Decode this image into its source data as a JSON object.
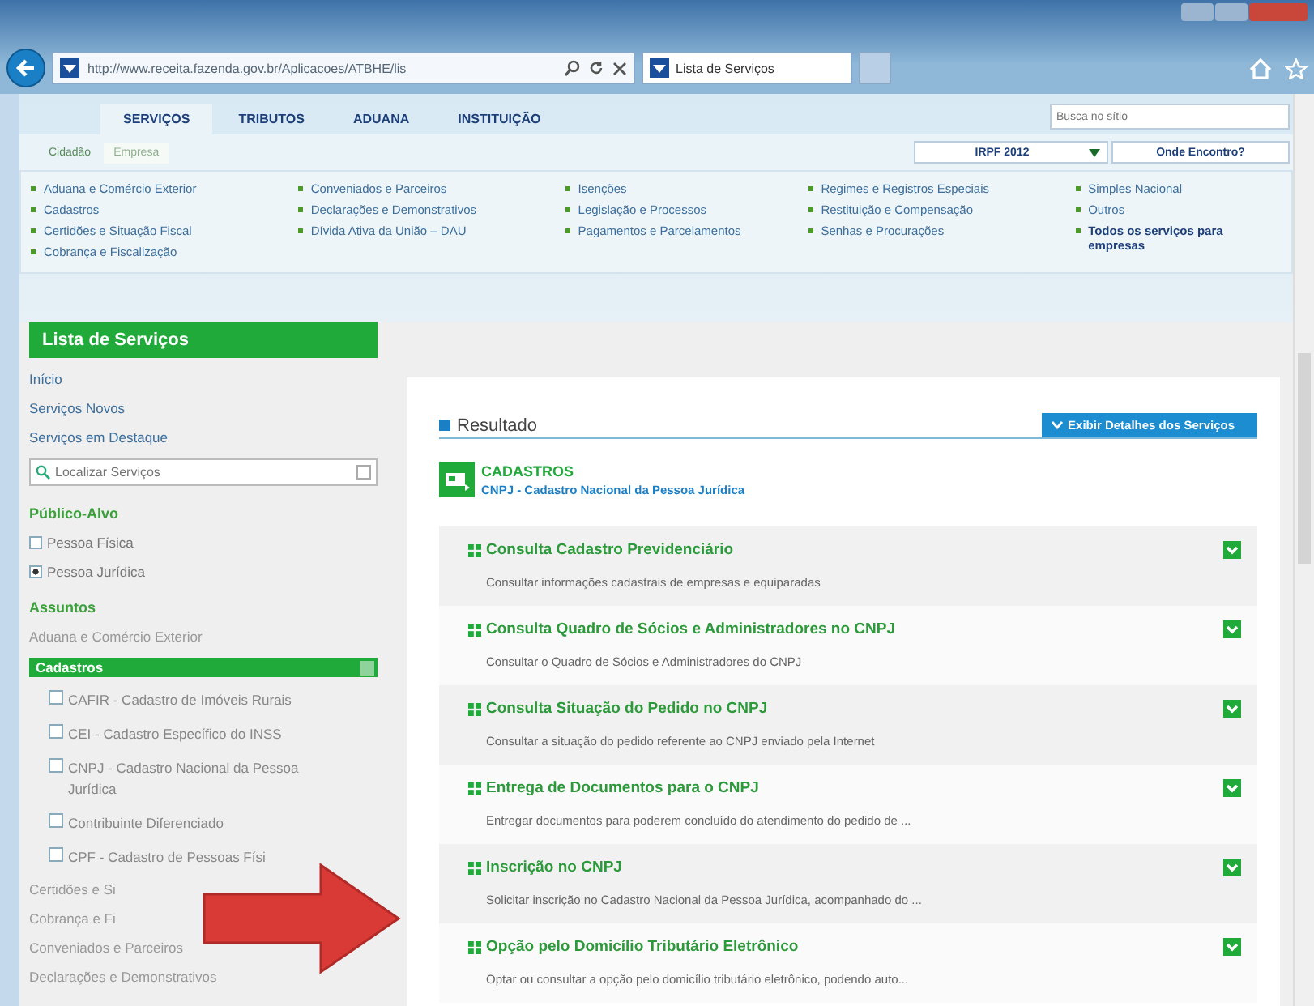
{
  "browser": {
    "address": "http://www.receita.fazenda.gov.br/Aplicacoes/ATBHE/lis",
    "tab_title": "Lista de Serviços"
  },
  "site": {
    "nav_tabs": [
      {
        "label": "SERVIÇOS",
        "selected": true
      },
      {
        "label": "TRIBUTOS",
        "selected": false
      },
      {
        "label": "ADUANA",
        "selected": false
      },
      {
        "label": "INSTITUIÇÃO",
        "selected": false
      }
    ],
    "search": {
      "placeholder": "Busca no sítio"
    },
    "sub_tabs": [
      {
        "label": "Cidadão",
        "selected": false
      },
      {
        "label": "Empresa",
        "selected": true
      }
    ],
    "year_select": "IRPF 2012",
    "help_link": "Onde Encontro?",
    "link_columns": [
      [
        {
          "label": "Aduana e Comércio Exterior",
          "emphasis": false
        },
        {
          "label": "Cadastros",
          "emphasis": false
        },
        {
          "label": "Certidões e Situação Fiscal",
          "emphasis": false
        },
        {
          "label": "Cobrança e Fiscalização",
          "emphasis": false
        }
      ],
      [
        {
          "label": "Conveniados e Parceiros",
          "emphasis": false
        },
        {
          "label": "Declarações e Demonstrativos",
          "emphasis": false
        },
        {
          "label": "Dívida Ativa da União – DAU",
          "emphasis": false
        }
      ],
      [
        {
          "label": "Isenções",
          "emphasis": false
        },
        {
          "label": "Legislação e Processos",
          "emphasis": false
        },
        {
          "label": "Pagamentos e Parcelamentos",
          "emphasis": false
        }
      ],
      [
        {
          "label": "Regimes e Registros Especiais",
          "emphasis": false
        },
        {
          "label": "Restituição e Compensação",
          "emphasis": false
        },
        {
          "label": "Senhas e Procurações",
          "emphasis": false
        }
      ],
      [
        {
          "label": "Simples Nacional",
          "emphasis": false
        },
        {
          "label": "Outros",
          "emphasis": false
        },
        {
          "label": "Todos os serviços para empresas",
          "emphasis": true
        }
      ]
    ]
  },
  "sidebar": {
    "title": "Lista de Serviços",
    "links": [
      "Início",
      "Serviços Novos",
      "Serviços em Destaque"
    ],
    "search": {
      "placeholder": "Localizar Serviços"
    },
    "audience_heading": "Público-Alvo",
    "audience": [
      {
        "label": "Pessoa Física",
        "selected": false
      },
      {
        "label": "Pessoa Jurídica",
        "selected": true
      }
    ],
    "subjects_heading": "Assuntos",
    "subjects": [
      {
        "label": "Aduana e Comércio Exterior",
        "expanded": false
      },
      {
        "label": "Cadastros",
        "expanded": true,
        "children": [
          {
            "label": "CAFIR - Cadastro de Imóveis Rurais",
            "checked": false
          },
          {
            "label": "CEI - Cadastro Específico do INSS",
            "checked": false
          },
          {
            "label": "CNPJ - Cadastro Nacional da Pessoa Jurídica",
            "checked": false
          },
          {
            "label": "Contribuinte Diferenciado",
            "checked": false
          },
          {
            "label": "CPF - Cadastro de Pessoas Físi",
            "checked": false
          }
        ]
      },
      {
        "label": "Certidões e Si",
        "expanded": false
      },
      {
        "label": "Cobrança e Fi",
        "expanded": false
      },
      {
        "label": "Conveniados e Parceiros",
        "expanded": false
      },
      {
        "label": "Declarações e Demonstrativos",
        "expanded": false
      }
    ]
  },
  "main": {
    "heading": "Resultado",
    "details_button": "Exibir Detalhes dos Serviços",
    "category": "CADASTROS",
    "subcategory": "CNPJ - Cadastro Nacional da Pessoa Jurídica",
    "services": [
      {
        "title": "Consulta Cadastro Previdenciário",
        "description": "Consultar informações cadastrais de empresas e equiparadas"
      },
      {
        "title": "Consulta Quadro de Sócios e Administradores no CNPJ",
        "description": "Consultar o Quadro de Sócios e Administradores do CNPJ"
      },
      {
        "title": "Consulta Situação do Pedido no CNPJ",
        "description": "Consultar a situação do pedido referente ao CNPJ enviado pela Internet"
      },
      {
        "title": "Entrega de Documentos para o CNPJ",
        "description": "Entregar documentos para poderem concluído do atendimento do pedido de ..."
      },
      {
        "title": "Inscrição no CNPJ",
        "description": "Solicitar inscrição no Cadastro Nacional da Pessoa Jurídica, acompanhado do ..."
      },
      {
        "title": "Opção pelo Domicílio Tributário Eletrônico",
        "description": "Optar ou consultar a opção pelo domicílio tributário eletrônico, podendo auto..."
      }
    ]
  }
}
